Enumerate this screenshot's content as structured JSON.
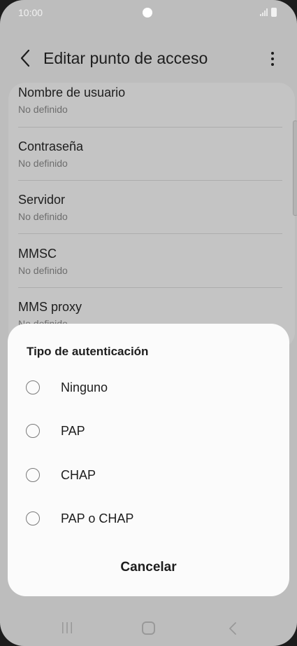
{
  "status_bar": {
    "time": "10:00"
  },
  "header": {
    "title": "Editar punto de acceso"
  },
  "settings": [
    {
      "label": "Nombre de usuario",
      "value": "No definido"
    },
    {
      "label": "Contraseña",
      "value": "No definido"
    },
    {
      "label": "Servidor",
      "value": "No definido"
    },
    {
      "label": "MMSC",
      "value": "No definido"
    },
    {
      "label": "MMS proxy",
      "value": "No definido"
    }
  ],
  "dialog": {
    "title": "Tipo de autenticación",
    "options": [
      {
        "label": "Ninguno",
        "selected": false
      },
      {
        "label": "PAP",
        "selected": false
      },
      {
        "label": "CHAP",
        "selected": false
      },
      {
        "label": "PAP o CHAP",
        "selected": false
      }
    ],
    "cancel_label": "Cancelar"
  },
  "colors": {
    "dimmed_background": "#bdbdbd",
    "sheet_background": "#fbfbfb",
    "text_primary": "#1d1d1d",
    "text_secondary": "#6d6d6d"
  }
}
